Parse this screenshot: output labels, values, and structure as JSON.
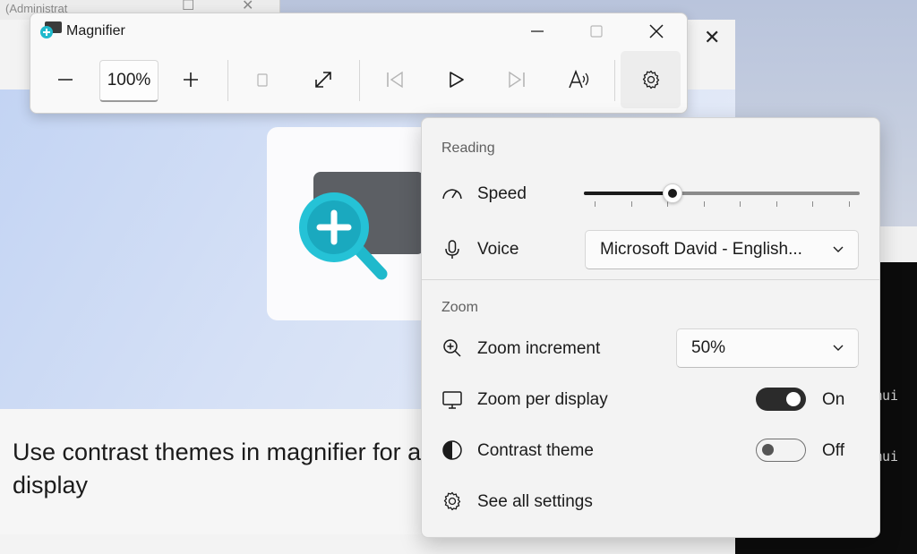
{
  "background": {
    "admin_window_title": "(Administrat",
    "article_heading": "Use contrast themes in magnifier for a display",
    "terminal_lines": [
      "mui",
      "mui"
    ]
  },
  "magnifier": {
    "title": "Magnifier",
    "zoom_level": "100%",
    "toolbar_icons": [
      "minus-icon",
      "plus-icon",
      "view-mode-icon",
      "full-screen-icon",
      "previous-icon",
      "play-icon",
      "next-icon",
      "read-aloud-icon",
      "gear-icon"
    ]
  },
  "flyout": {
    "reading": {
      "header": "Reading",
      "speed_label": "Speed",
      "speed_value_fraction": 0.32,
      "speed_tick_count": 8,
      "voice_label": "Voice",
      "voice_value": "Microsoft David - English..."
    },
    "zoom": {
      "header": "Zoom",
      "increment_label": "Zoom increment",
      "increment_value": "50%",
      "per_display_label": "Zoom per display",
      "per_display_state": "On",
      "contrast_label": "Contrast theme",
      "contrast_state": "Off",
      "see_all_label": "See all settings"
    }
  },
  "colors": {
    "toggle_on": "#2b2b2b",
    "accent_text": "#1b1b1b",
    "magnifier_icon": "#1fb9cc"
  }
}
